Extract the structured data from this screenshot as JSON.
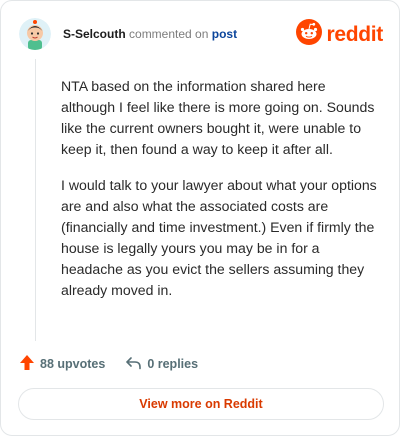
{
  "comment": {
    "username": "S-Selcouth",
    "action_text": "commented on",
    "post_link": "post",
    "paragraphs": [
      "NTA based on the information shared here although I feel like there is more going on. Sounds like the current owners bought it, were unable to keep it, then found a way to keep it after all.",
      "I would talk to your lawyer about what your options are and also what the associated costs are (financially and time investment.) Even if firmly the house is legally yours you may be in for a headache as you evict the sellers assuming they already moved in."
    ]
  },
  "brand": {
    "name": "reddit",
    "icon": "reddit-logo-icon",
    "color": "#ff4500"
  },
  "footer": {
    "upvotes_label": "88 upvotes",
    "replies_label": "0 replies"
  },
  "cta": {
    "label": "View more on Reddit"
  }
}
